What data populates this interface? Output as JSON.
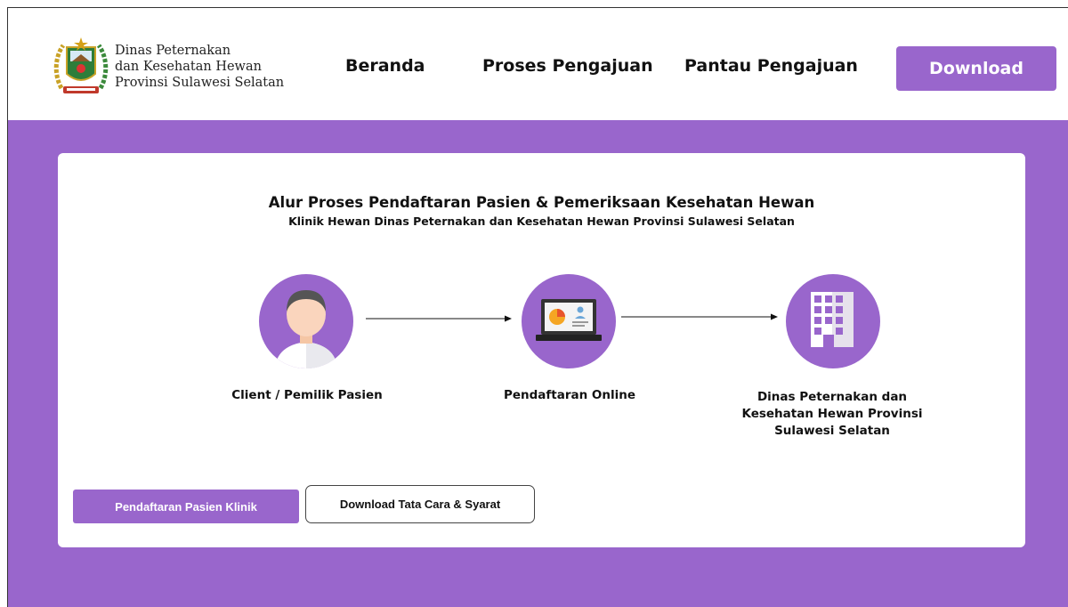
{
  "header": {
    "org_line1": "Dinas Peternakan",
    "org_line2": "dan Kesehatan Hewan",
    "org_line3": "Provinsi Sulawesi Selatan",
    "logo_icon": "provincial-crest-logo",
    "nav": {
      "beranda": "Beranda",
      "proses": "Proses Pengajuan",
      "pantau": "Pantau Pengajuan"
    },
    "download_label": "Download"
  },
  "main": {
    "title": "Alur Proses Pendaftaran Pasien & Pemeriksaan Kesehatan Hewan",
    "subtitle": "Klinik Hewan Dinas Peternakan dan Kesehatan Hewan Provinsi Sulawesi Selatan",
    "steps": [
      {
        "label": "Client / Pemilik Pasien",
        "icon": "person-icon"
      },
      {
        "label": "Pendaftaran Online",
        "icon": "laptop-icon"
      },
      {
        "label_lines": [
          "Dinas Peternakan dan",
          "Kesehatan Hewan Provinsi",
          "Sulawesi Selatan"
        ],
        "icon": "building-icon"
      }
    ],
    "buttons": {
      "daftar": "Pendaftaran Pasien Klinik",
      "tatacara": "Download Tata Cara & Syarat"
    }
  },
  "colors": {
    "accent": "#9966cc",
    "card_bg": "#ffffff",
    "text": "#111111"
  }
}
